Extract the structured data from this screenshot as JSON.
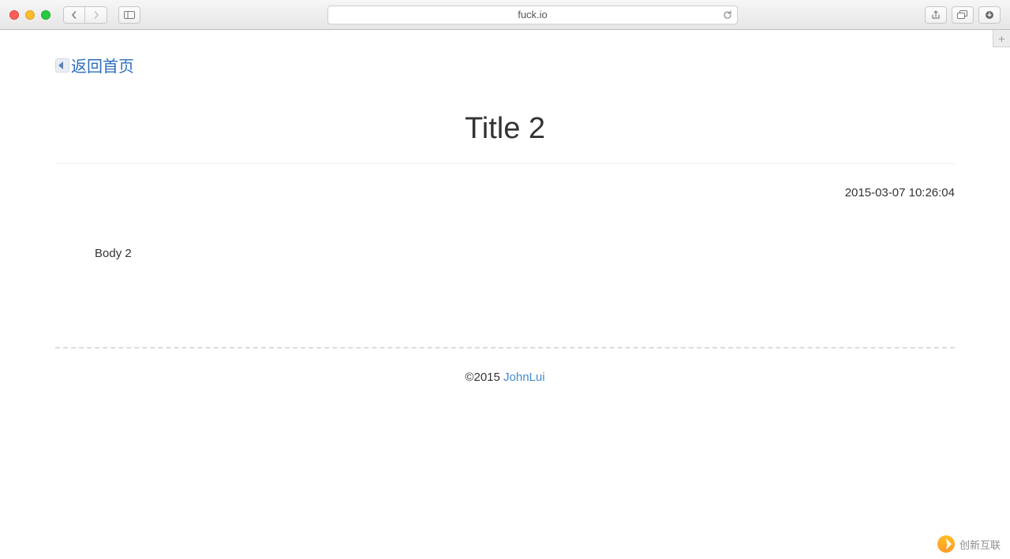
{
  "browser": {
    "url": "fuck.io"
  },
  "page": {
    "back_link_text": "返回首页",
    "title": "Title 2",
    "timestamp": "2015-03-07 10:26:04",
    "body": "Body 2",
    "copyright": "©2015 ",
    "author_link": "JohnLui"
  },
  "watermark": {
    "text": "创新互联"
  }
}
